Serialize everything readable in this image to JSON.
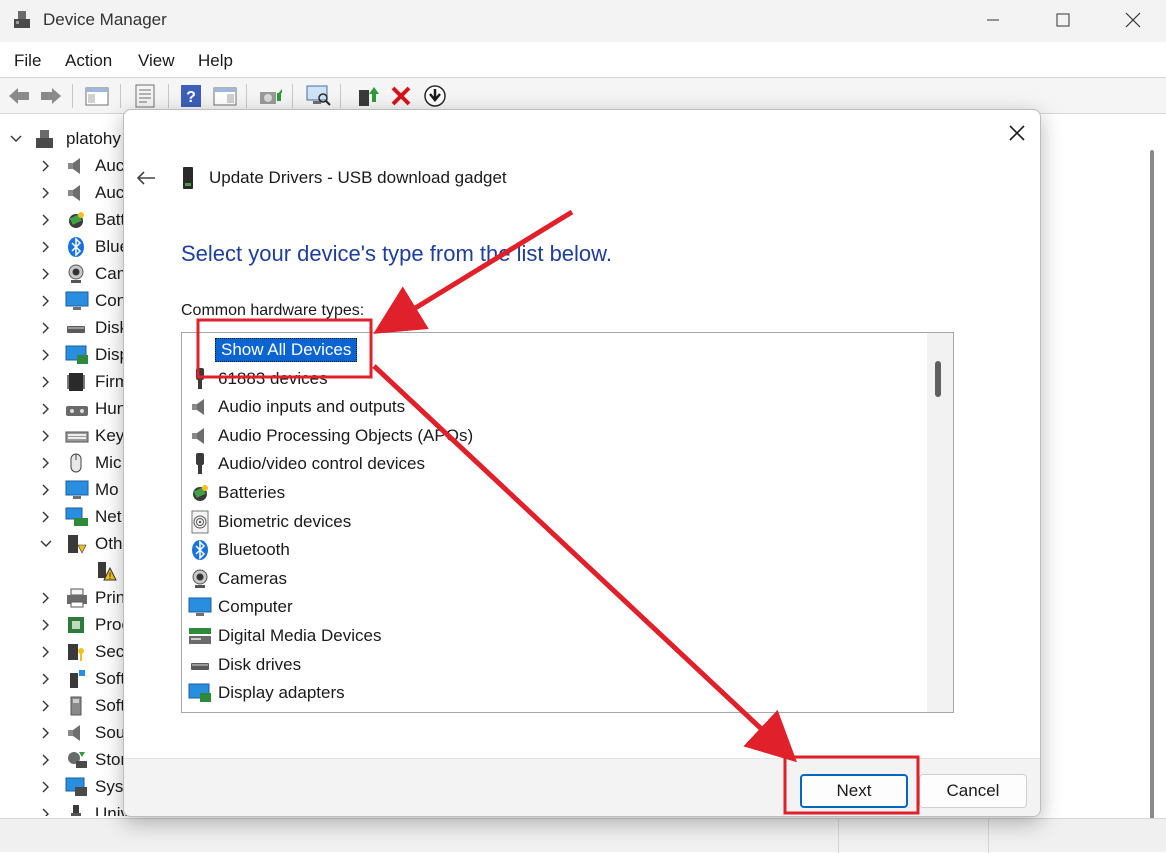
{
  "window": {
    "title": "Device Manager",
    "menu": [
      "File",
      "Action",
      "View",
      "Help"
    ]
  },
  "tree": {
    "root": "platohy",
    "nodes": [
      {
        "label": "Auc",
        "icon": "speaker-icon",
        "expanded": false
      },
      {
        "label": "Auc",
        "icon": "speaker-icon",
        "expanded": false
      },
      {
        "label": "Batt",
        "icon": "battery-icon",
        "expanded": false
      },
      {
        "label": "Blue",
        "icon": "bluetooth-icon",
        "expanded": false
      },
      {
        "label": "Cam",
        "icon": "camera-icon",
        "expanded": false
      },
      {
        "label": "Con",
        "icon": "computer-icon",
        "expanded": false
      },
      {
        "label": "Disk",
        "icon": "disk-drive-icon",
        "expanded": false
      },
      {
        "label": "Disp",
        "icon": "display-adapter-icon",
        "expanded": false
      },
      {
        "label": "Firm",
        "icon": "firmware-icon",
        "expanded": false
      },
      {
        "label": "Hun",
        "icon": "hid-icon",
        "expanded": false
      },
      {
        "label": "Key",
        "icon": "keyboard-icon",
        "expanded": false
      },
      {
        "label": "Mic",
        "icon": "mouse-icon",
        "expanded": false
      },
      {
        "label": "Mo",
        "icon": "monitor-icon",
        "expanded": false
      },
      {
        "label": "Net",
        "icon": "network-icon",
        "expanded": false
      },
      {
        "label": "Oth",
        "icon": "other-devices-icon",
        "expanded": true
      },
      {
        "label": "",
        "icon": "warning-device-icon",
        "expanded": false,
        "child": true
      },
      {
        "label": "Prin",
        "icon": "printer-icon",
        "expanded": false
      },
      {
        "label": "Proc",
        "icon": "processor-icon",
        "expanded": false
      },
      {
        "label": "Sec",
        "icon": "security-icon",
        "expanded": false
      },
      {
        "label": "Soft",
        "icon": "software-component-icon",
        "expanded": false
      },
      {
        "label": "Soft",
        "icon": "software-device-icon",
        "expanded": false
      },
      {
        "label": "Sou",
        "icon": "sound-icon",
        "expanded": false
      },
      {
        "label": "Stor",
        "icon": "storage-icon",
        "expanded": false
      },
      {
        "label": "Syst",
        "icon": "system-icon",
        "expanded": false
      },
      {
        "label": "Univ",
        "icon": "usb-icon",
        "expanded": false
      }
    ]
  },
  "dialog": {
    "title": "Update Drivers - USB download gadget",
    "heading": "Select your device's type from the list below.",
    "list_label": "Common hardware types:",
    "items": [
      {
        "label": "Show All Devices",
        "icon": "",
        "selected": true
      },
      {
        "label": "61883 devices",
        "icon": "plug-icon",
        "selected": false
      },
      {
        "label": "Audio inputs and outputs",
        "icon": "speaker-icon",
        "selected": false
      },
      {
        "label": "Audio Processing Objects (APOs)",
        "icon": "speaker-icon",
        "selected": false
      },
      {
        "label": "Audio/video control devices",
        "icon": "plug-icon",
        "selected": false
      },
      {
        "label": "Batteries",
        "icon": "battery-icon",
        "selected": false
      },
      {
        "label": "Biometric devices",
        "icon": "fingerprint-icon",
        "selected": false
      },
      {
        "label": "Bluetooth",
        "icon": "bluetooth-icon",
        "selected": false
      },
      {
        "label": "Cameras",
        "icon": "camera-icon",
        "selected": false
      },
      {
        "label": "Computer",
        "icon": "computer-icon",
        "selected": false
      },
      {
        "label": "Digital Media Devices",
        "icon": "media-device-icon",
        "selected": false
      },
      {
        "label": "Disk drives",
        "icon": "disk-drive-icon",
        "selected": false
      },
      {
        "label": "Display adapters",
        "icon": "display-adapter-icon",
        "selected": false
      }
    ],
    "next_label": "Next",
    "cancel_label": "Cancel"
  },
  "colors": {
    "heading_blue": "#1f3e9a",
    "selection_blue": "#0a64d2",
    "annotation_red": "#e0202a"
  }
}
